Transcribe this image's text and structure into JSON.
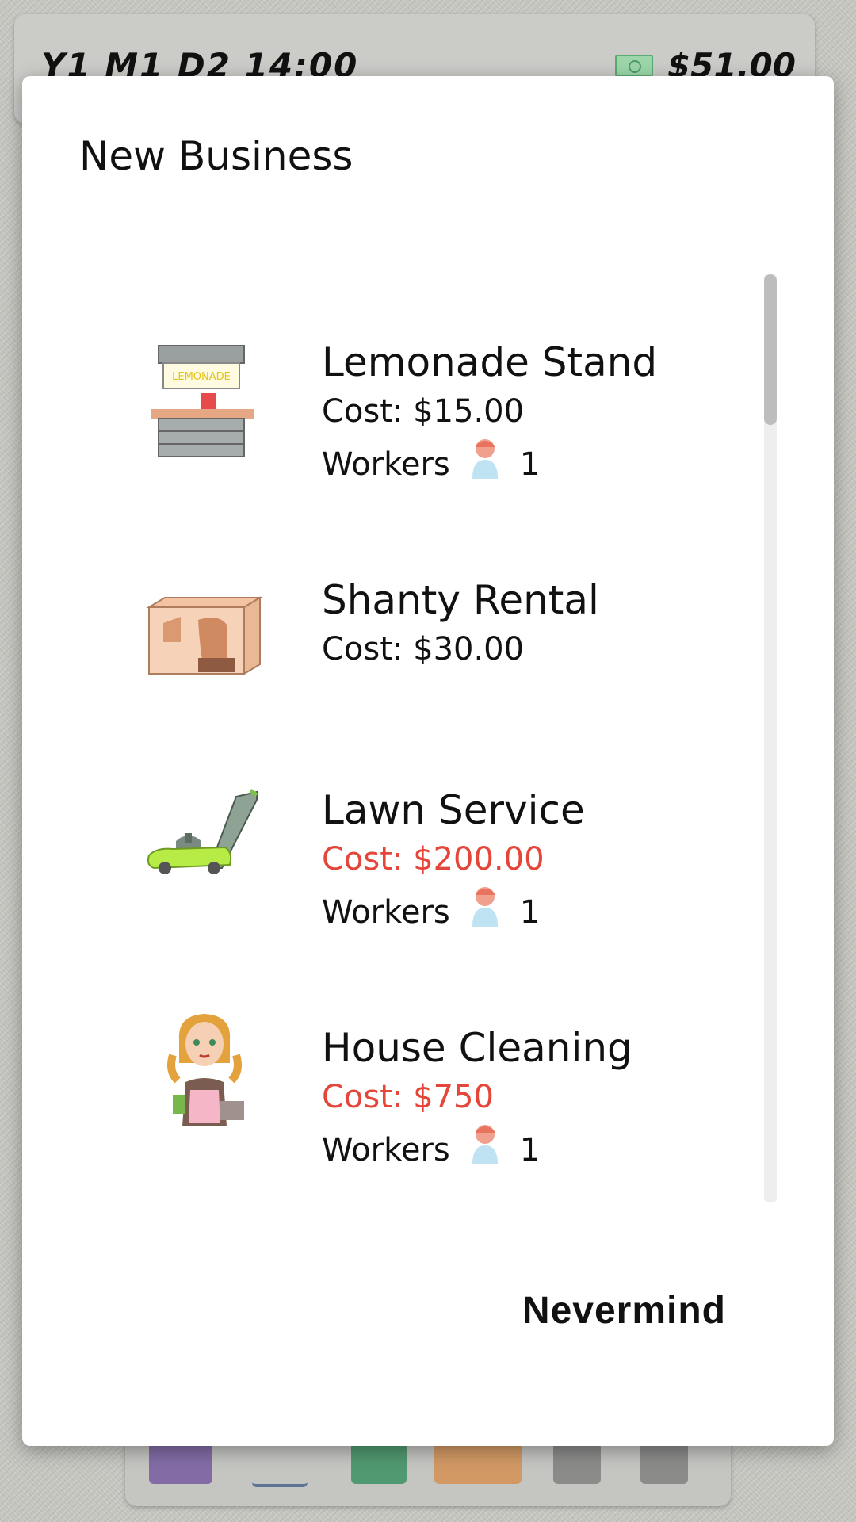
{
  "status": {
    "date": "Y1 M1 D2 14:00",
    "money": "$51.00"
  },
  "dialog": {
    "title": "New Business",
    "items": [
      {
        "name": "Lemonade Stand",
        "cost": "Cost: $15.00",
        "affordable": true,
        "workers_label": "Workers",
        "workers": "1",
        "icon": "lemonade-stand-icon"
      },
      {
        "name": "Shanty Rental",
        "cost": "Cost: $30.00",
        "affordable": true,
        "icon": "shanty-icon"
      },
      {
        "name": "Lawn Service",
        "cost": "Cost: $200.00",
        "affordable": false,
        "workers_label": "Workers",
        "workers": "1",
        "icon": "lawn-mower-icon"
      },
      {
        "name": "House Cleaning",
        "cost": "Cost: $750",
        "affordable": false,
        "workers_label": "Workers",
        "workers": "1",
        "icon": "maid-icon"
      }
    ],
    "cancel_label": "Nevermind"
  },
  "colors": {
    "unaffordable": "#e5463a",
    "dialog_bg": "#ffffff",
    "screen_bg": "#c9c9c4"
  }
}
